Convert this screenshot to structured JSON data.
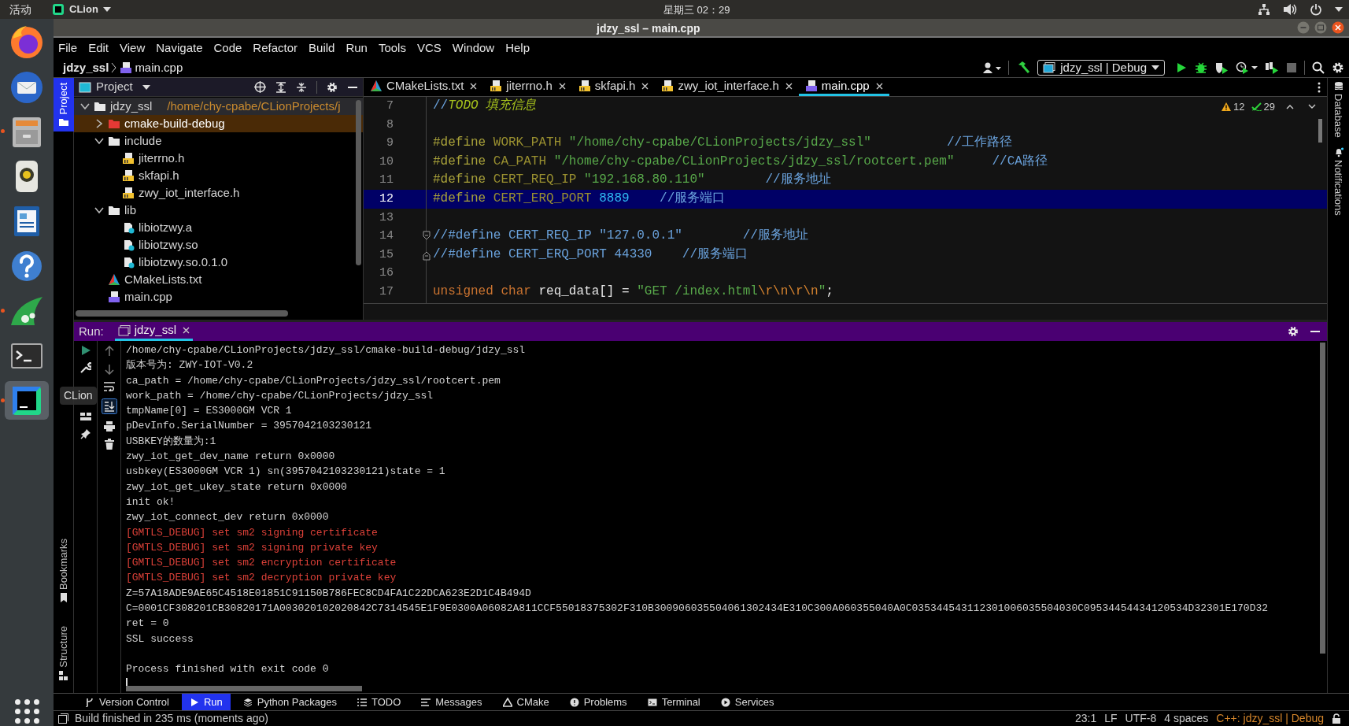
{
  "top_bar": {
    "activities": "活动",
    "app_menu": "CLion",
    "clock": "星期三 02：29"
  },
  "dock": {
    "items": [
      {
        "kind": "firefox",
        "running": false,
        "selected": false
      },
      {
        "kind": "thunderbird",
        "running": false,
        "selected": false
      },
      {
        "kind": "files",
        "running": true,
        "selected": false
      },
      {
        "kind": "speaker",
        "running": false,
        "selected": false
      },
      {
        "kind": "writer",
        "running": false,
        "selected": false
      },
      {
        "kind": "help",
        "running": false,
        "selected": false
      },
      {
        "kind": "wireshark",
        "running": true,
        "selected": false
      },
      {
        "kind": "terminal",
        "running": false,
        "selected": false
      },
      {
        "kind": "clion",
        "running": true,
        "selected": true
      },
      {
        "kind": "apps",
        "running": false,
        "selected": false
      }
    ],
    "tooltip": "CLion"
  },
  "window": {
    "title": "jdzy_ssl – main.cpp"
  },
  "menu": [
    "File",
    "Edit",
    "View",
    "Navigate",
    "Code",
    "Refactor",
    "Build",
    "Run",
    "Tools",
    "VCS",
    "Window",
    "Help"
  ],
  "breadcrumb": [
    "jdzy_ssl",
    "main.cpp"
  ],
  "run_config": "jdzy_ssl | Debug",
  "left_stripe": {
    "top": [
      {
        "label": "Project",
        "kind": "folder",
        "selected": true
      }
    ],
    "bottom": [
      {
        "label": "Bookmarks",
        "kind": "bookmark",
        "selected": false
      },
      {
        "label": "Structure",
        "kind": "structure",
        "selected": false
      }
    ]
  },
  "right_stripe": [
    {
      "label": "Database",
      "kind": "database"
    },
    {
      "label": "Notifications",
      "kind": "bell"
    }
  ],
  "project": {
    "title": "Project",
    "tree": [
      {
        "label": "jdzy_ssl",
        "path": "/home/chy-cpabe/CLionProjects/j",
        "kind": "folder",
        "expanded": true,
        "selected": false,
        "children": [
          {
            "label": "cmake-build-debug",
            "kind": "excluded",
            "expanded": false,
            "selected": true
          },
          {
            "label": "include",
            "kind": "folder",
            "expanded": true,
            "selected": false,
            "children": [
              {
                "label": "jiterrno.h",
                "kind": "header",
                "selected": false
              },
              {
                "label": "skfapi.h",
                "kind": "header",
                "selected": false
              },
              {
                "label": "zwy_iot_interface.h",
                "kind": "header",
                "selected": false
              }
            ]
          },
          {
            "label": "lib",
            "kind": "folder",
            "expanded": true,
            "selected": false,
            "children": [
              {
                "label": "libiotzwy.a",
                "kind": "lib",
                "selected": false
              },
              {
                "label": "libiotzwy.so",
                "kind": "lib",
                "selected": false
              },
              {
                "label": "libiotzwy.so.0.1.0",
                "kind": "lib",
                "selected": false
              }
            ]
          },
          {
            "label": "CMakeLists.txt",
            "kind": "cmake",
            "selected": false
          },
          {
            "label": "main.cpp",
            "kind": "cpp",
            "selected": false
          }
        ]
      }
    ]
  },
  "editor": {
    "tabs": [
      {
        "label": "CMakeLists.txt",
        "kind": "cmake",
        "selected": false
      },
      {
        "label": "jiterrno.h",
        "kind": "header",
        "selected": false
      },
      {
        "label": "skfapi.h",
        "kind": "header",
        "selected": false
      },
      {
        "label": "zwy_iot_interface.h",
        "kind": "header",
        "selected": false
      },
      {
        "label": "main.cpp",
        "kind": "cpp",
        "selected": true
      }
    ],
    "warnings": "12",
    "passed": "29",
    "lines": [
      {
        "number": "7",
        "current": false,
        "fold_start": false,
        "fold_end": false,
        "tokens": [
          {
            "kind": "comment",
            "text": "//"
          },
          {
            "kind": "todo",
            "text": "TODO 填充信息"
          }
        ]
      },
      {
        "number": "8",
        "current": false,
        "fold_start": false,
        "fold_end": false
      },
      {
        "number": "9",
        "current": false,
        "fold_start": false,
        "fold_end": false,
        "tokens": [
          {
            "kind": "directive",
            "text": "#define "
          },
          {
            "kind": "macro",
            "text": "WORK_PATH "
          },
          {
            "kind": "string",
            "text": "\"/home/chy-cpabe/CLionProjects/jdzy_ssl\"          "
          },
          {
            "kind": "comment",
            "text": "//工作路径"
          }
        ]
      },
      {
        "number": "10",
        "current": false,
        "fold_start": false,
        "fold_end": false,
        "tokens": [
          {
            "kind": "directive",
            "text": "#define "
          },
          {
            "kind": "macro",
            "text": "CA_PATH "
          },
          {
            "kind": "string",
            "text": "\"/home/chy-cpabe/CLionProjects/jdzy_ssl/rootcert.pem\"     "
          },
          {
            "kind": "comment",
            "text": "//CA路径"
          }
        ]
      },
      {
        "number": "11",
        "current": false,
        "fold_start": false,
        "fold_end": false,
        "tokens": [
          {
            "kind": "directive",
            "text": "#define "
          },
          {
            "kind": "macro",
            "text": "CERT_REQ_IP "
          },
          {
            "kind": "string",
            "text": "\"192.168.80.110\"        "
          },
          {
            "kind": "comment",
            "text": "//服务地址"
          }
        ]
      },
      {
        "number": "12",
        "current": true,
        "fold_start": false,
        "fold_end": false,
        "tokens": [
          {
            "kind": "directive",
            "text": "#define "
          },
          {
            "kind": "macro",
            "text": "CERT_ERQ_PORT "
          },
          {
            "kind": "number",
            "text": "8889    "
          },
          {
            "kind": "comment",
            "text": "//服务端口"
          }
        ]
      },
      {
        "number": "13",
        "current": false,
        "fold_start": false,
        "fold_end": false
      },
      {
        "number": "14",
        "current": false,
        "fold_start": true,
        "fold_end": false,
        "tokens": [
          {
            "kind": "comment",
            "text": "//#define CERT_REQ_IP \"127.0.0.1\"        //服务地址"
          }
        ]
      },
      {
        "number": "15",
        "current": false,
        "fold_start": false,
        "fold_end": true,
        "tokens": [
          {
            "kind": "comment",
            "text": "//#define CERT_ERQ_PORT 44330    //服务端口"
          }
        ]
      },
      {
        "number": "16",
        "current": false,
        "fold_start": false,
        "fold_end": false
      },
      {
        "number": "17",
        "current": false,
        "fold_start": false,
        "fold_end": false,
        "tokens": [
          {
            "kind": "keyword",
            "text": "unsigned "
          },
          {
            "kind": "keyword",
            "text": "char "
          },
          {
            "kind": "plain",
            "text": "req_data[] = "
          },
          {
            "kind": "string",
            "text": "\"GET /index.html"
          },
          {
            "kind": "escape",
            "text": "\\r\\n\\r\\n"
          },
          {
            "kind": "string",
            "text": "\""
          },
          {
            "kind": "plain",
            "text": ";"
          }
        ]
      }
    ]
  },
  "run": {
    "label": "Run:",
    "tab": "jdzy_ssl",
    "lines": [
      {
        "kind": "out",
        "text": "/home/chy-cpabe/CLionProjects/jdzy_ssl/cmake-build-debug/jdzy_ssl"
      },
      {
        "kind": "out",
        "text": "版本号为: ZWY-IOT-V0.2"
      },
      {
        "kind": "out",
        "text": "ca_path = /home/chy-cpabe/CLionProjects/jdzy_ssl/rootcert.pem"
      },
      {
        "kind": "out",
        "text": "work_path = /home/chy-cpabe/CLionProjects/jdzy_ssl"
      },
      {
        "kind": "out",
        "text": "tmpName[0] = ES3000GM VCR 1"
      },
      {
        "kind": "out",
        "text": "pDevInfo.SerialNumber = 3957042103230121"
      },
      {
        "kind": "out",
        "text": "USBKEY的数量为:1"
      },
      {
        "kind": "out",
        "text": "zwy_iot_get_dev_name return 0x0000"
      },
      {
        "kind": "out",
        "text": "usbkey(ES3000GM VCR 1) sn(3957042103230121)state = 1"
      },
      {
        "kind": "out",
        "text": "zwy_iot_get_ukey_state return 0x0000"
      },
      {
        "kind": "out",
        "text": "init ok!"
      },
      {
        "kind": "out",
        "text": "zwy_iot_connect_dev return 0x0000"
      },
      {
        "kind": "error",
        "text": "[GMTLS_DEBUG] set sm2 signing certificate"
      },
      {
        "kind": "error",
        "text": "[GMTLS_DEBUG] set sm2 signing private key"
      },
      {
        "kind": "error",
        "text": "[GMTLS_DEBUG] set sm2 encryption certificate"
      },
      {
        "kind": "error",
        "text": "[GMTLS_DEBUG] set sm2 decryption private key"
      },
      {
        "kind": "out",
        "text": "Z=57A18ADE9AE65C4518E01851C91150B786FEC8CD4FA1C22DCA623E2D1C4B494D"
      },
      {
        "kind": "out",
        "text": "C=0001CF308201CB30820171A003020102020842C7314545E1F9E0300A06082A811CCF55018375302F310B300906035504061302434E310C300A060355040A0C035344543112301006035504030C09534454434120534D32301E170D32"
      },
      {
        "kind": "out",
        "text": "ret = 0"
      },
      {
        "kind": "out",
        "text": "SSL success"
      },
      {
        "kind": "exit",
        "text": "Process finished with exit code 0"
      }
    ]
  },
  "tool_tabs": [
    {
      "label": "Version Control",
      "kind": "vcs",
      "selected": false
    },
    {
      "label": "Run",
      "kind": "run",
      "selected": true
    },
    {
      "label": "Python Packages",
      "kind": "packages",
      "selected": false
    },
    {
      "label": "TODO",
      "kind": "todo",
      "selected": false
    },
    {
      "label": "Messages",
      "kind": "messages",
      "selected": false
    },
    {
      "label": "CMake",
      "kind": "cmake",
      "selected": false
    },
    {
      "label": "Problems",
      "kind": "problems",
      "selected": false
    },
    {
      "label": "Terminal",
      "kind": "terminal",
      "selected": false
    },
    {
      "label": "Services",
      "kind": "services",
      "selected": false
    }
  ],
  "status": {
    "message": "Build finished in 235 ms (moments ago)",
    "items": [
      {
        "text": "23:1",
        "kind": "plain"
      },
      {
        "text": "LF",
        "kind": "plain"
      },
      {
        "text": "UTF-8",
        "kind": "plain"
      },
      {
        "text": "4 spaces",
        "kind": "plain"
      },
      {
        "text": "C++: jdzy_ssl | Debug",
        "kind": "context"
      }
    ]
  }
}
